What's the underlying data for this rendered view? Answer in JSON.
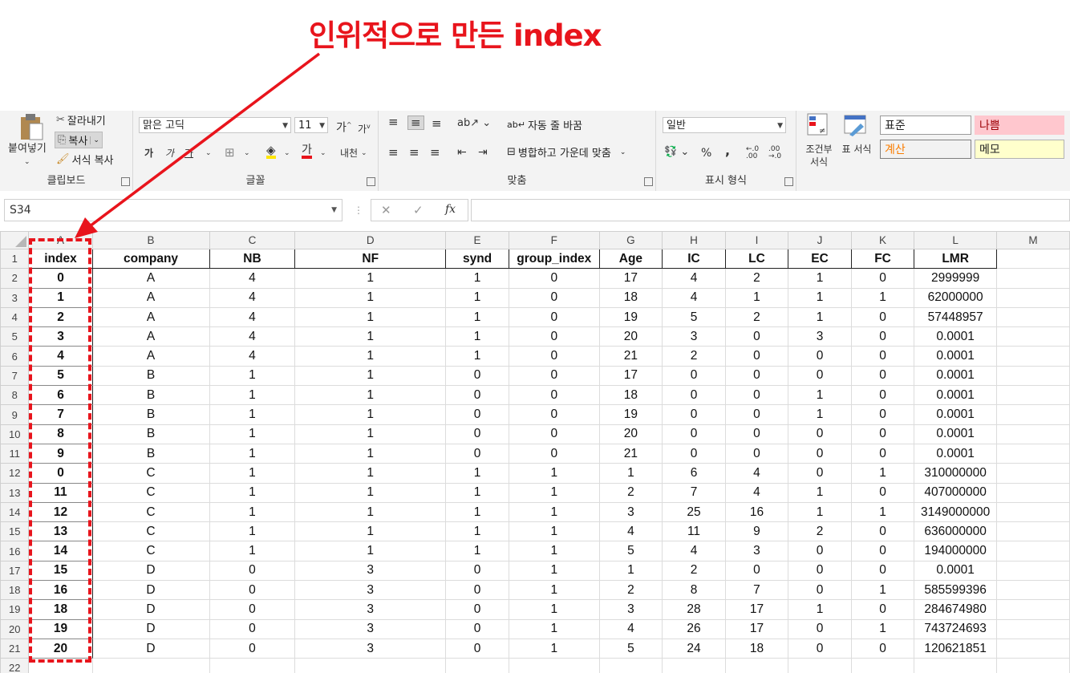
{
  "annotation": {
    "text": "인위적으로 만든 index",
    "color": "#e8141c"
  },
  "ribbon": {
    "clipboard": {
      "paste": "붙여넣기",
      "cut": "잘라내기",
      "copy": "복사",
      "format_painter": "서식 복사",
      "label": "클립보드"
    },
    "font": {
      "font_name": "맑은 고딕",
      "font_size": "11",
      "grow": "가",
      "shrink": "가",
      "bold": "가",
      "italic": "가",
      "underline": "가",
      "font_color": "가",
      "phonetic": "내천",
      "label": "글꼴"
    },
    "alignment": {
      "wrap_text": "자동 줄 바꿈",
      "merge": "병합하고 가운데 맞춤",
      "label": "맞춤"
    },
    "number": {
      "format": "일반",
      "percent": "%",
      "comma": ",",
      "label": "표시 형식"
    },
    "styles": {
      "conditional": "조건부 서식",
      "table": "표 서식",
      "normal": "표준",
      "bad": "나쁨",
      "calculation": "계산",
      "note": "메모"
    }
  },
  "formula_bar": {
    "name_box": "S34",
    "fx": "fx",
    "formula": ""
  },
  "sheet": {
    "columns": [
      "A",
      "B",
      "C",
      "D",
      "E",
      "F",
      "G",
      "H",
      "I",
      "J",
      "K",
      "L",
      "M"
    ],
    "headers": [
      "index",
      "company",
      "NB",
      "NF",
      "synd",
      "group_index",
      "Age",
      "IC",
      "LC",
      "EC",
      "FC",
      "LMR"
    ],
    "rows": [
      [
        "0",
        "A",
        "4",
        "1",
        "1",
        "0",
        "17",
        "4",
        "2",
        "1",
        "0",
        "2999999"
      ],
      [
        "1",
        "A",
        "4",
        "1",
        "1",
        "0",
        "18",
        "4",
        "1",
        "1",
        "1",
        "62000000"
      ],
      [
        "2",
        "A",
        "4",
        "1",
        "1",
        "0",
        "19",
        "5",
        "2",
        "1",
        "0",
        "57448957"
      ],
      [
        "3",
        "A",
        "4",
        "1",
        "1",
        "0",
        "20",
        "3",
        "0",
        "3",
        "0",
        "0.0001"
      ],
      [
        "4",
        "A",
        "4",
        "1",
        "1",
        "0",
        "21",
        "2",
        "0",
        "0",
        "0",
        "0.0001"
      ],
      [
        "5",
        "B",
        "1",
        "1",
        "0",
        "0",
        "17",
        "0",
        "0",
        "0",
        "0",
        "0.0001"
      ],
      [
        "6",
        "B",
        "1",
        "1",
        "0",
        "0",
        "18",
        "0",
        "0",
        "1",
        "0",
        "0.0001"
      ],
      [
        "7",
        "B",
        "1",
        "1",
        "0",
        "0",
        "19",
        "0",
        "0",
        "1",
        "0",
        "0.0001"
      ],
      [
        "8",
        "B",
        "1",
        "1",
        "0",
        "0",
        "20",
        "0",
        "0",
        "0",
        "0",
        "0.0001"
      ],
      [
        "9",
        "B",
        "1",
        "1",
        "0",
        "0",
        "21",
        "0",
        "0",
        "0",
        "0",
        "0.0001"
      ],
      [
        "0",
        "C",
        "1",
        "1",
        "1",
        "1",
        "1",
        "6",
        "4",
        "0",
        "1",
        "310000000"
      ],
      [
        "11",
        "C",
        "1",
        "1",
        "1",
        "1",
        "2",
        "7",
        "4",
        "1",
        "0",
        "407000000"
      ],
      [
        "12",
        "C",
        "1",
        "1",
        "1",
        "1",
        "3",
        "25",
        "16",
        "1",
        "1",
        "3149000000"
      ],
      [
        "13",
        "C",
        "1",
        "1",
        "1",
        "1",
        "4",
        "11",
        "9",
        "2",
        "0",
        "636000000"
      ],
      [
        "14",
        "C",
        "1",
        "1",
        "1",
        "1",
        "5",
        "4",
        "3",
        "0",
        "0",
        "194000000"
      ],
      [
        "15",
        "D",
        "0",
        "3",
        "0",
        "1",
        "1",
        "2",
        "0",
        "0",
        "0",
        "0.0001"
      ],
      [
        "16",
        "D",
        "0",
        "3",
        "0",
        "1",
        "2",
        "8",
        "7",
        "0",
        "1",
        "585599396"
      ],
      [
        "18",
        "D",
        "0",
        "3",
        "0",
        "1",
        "3",
        "28",
        "17",
        "1",
        "0",
        "284674980"
      ],
      [
        "19",
        "D",
        "0",
        "3",
        "0",
        "1",
        "4",
        "26",
        "17",
        "0",
        "1",
        "743724693"
      ],
      [
        "20",
        "D",
        "0",
        "3",
        "0",
        "1",
        "5",
        "24",
        "18",
        "0",
        "0",
        "120621851"
      ]
    ],
    "row_numbers": [
      "1",
      "2",
      "3",
      "4",
      "5",
      "6",
      "7",
      "8",
      "9",
      "10",
      "11",
      "12",
      "13",
      "14",
      "15",
      "16",
      "17",
      "18",
      "19",
      "20",
      "21",
      "22"
    ]
  }
}
